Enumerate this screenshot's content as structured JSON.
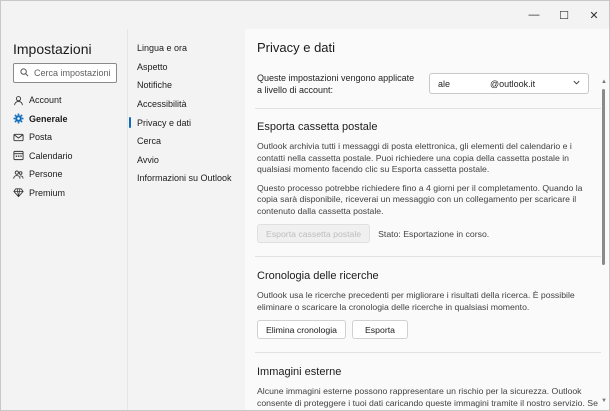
{
  "titlebar": {
    "min": "—",
    "max": "☐",
    "close": "✕"
  },
  "nav1": {
    "title": "Impostazioni",
    "search_placeholder": "Cerca impostazioni",
    "items": [
      {
        "label": "Account",
        "icon": "person-icon"
      },
      {
        "label": "Generale",
        "icon": "gear-icon",
        "active": true
      },
      {
        "label": "Posta",
        "icon": "mail-icon"
      },
      {
        "label": "Calendario",
        "icon": "calendar-icon"
      },
      {
        "label": "Persone",
        "icon": "people-icon"
      },
      {
        "label": "Premium",
        "icon": "diamond-icon"
      }
    ]
  },
  "nav2": {
    "items": [
      {
        "label": "Lingua e ora"
      },
      {
        "label": "Aspetto"
      },
      {
        "label": "Notifiche"
      },
      {
        "label": "Accessibilità"
      },
      {
        "label": "Privacy e dati",
        "active": true
      },
      {
        "label": "Cerca"
      },
      {
        "label": "Avvio"
      },
      {
        "label": "Informazioni su Outlook"
      }
    ]
  },
  "main": {
    "title": "Privacy e dati",
    "account_label": "Queste impostazioni vengono applicate a livello di account:",
    "account_value": "ale                @outlook.it",
    "export": {
      "title": "Esporta cassetta postale",
      "text1": "Outlook archivia tutti i messaggi di posta elettronica, gli elementi del calendario e i contatti nella cassetta postale. Puoi richiedere una copia della cassetta postale in qualsiasi momento facendo clic su Esporta cassetta postale.",
      "text2": "Questo processo potrebbe richiedere fino a 4 giorni per il completamento. Quando la copia sarà disponibile, riceverai un messaggio con un collegamento per scaricare il contenuto dalla cassetta postale.",
      "button": "Esporta cassetta postale",
      "status": "Stato: Esportazione in corso."
    },
    "history": {
      "title": "Cronologia delle ricerche",
      "text": "Outlook usa le ricerche precedenti per migliorare i risultati della ricerca. È possibile eliminare o scaricare la cronologia delle ricerche in qualsiasi momento.",
      "delete_button": "Elimina cronologia",
      "export_button": "Esporta"
    },
    "images": {
      "title": "Immagini esterne",
      "text": "Alcune immagini esterne possono rappresentare un rischio per la sicurezza. Outlook consente di proteggere i tuoi dati caricando queste immagini tramite il nostro servizio. Se scegli di non caricare le immagini tramite Outlook, rischi di esporre il tuo dispositivo a"
    }
  },
  "colors": {
    "accent": "#0f6cbd",
    "window_bg": "#f3f3f3",
    "content_bg": "#fafafa"
  }
}
